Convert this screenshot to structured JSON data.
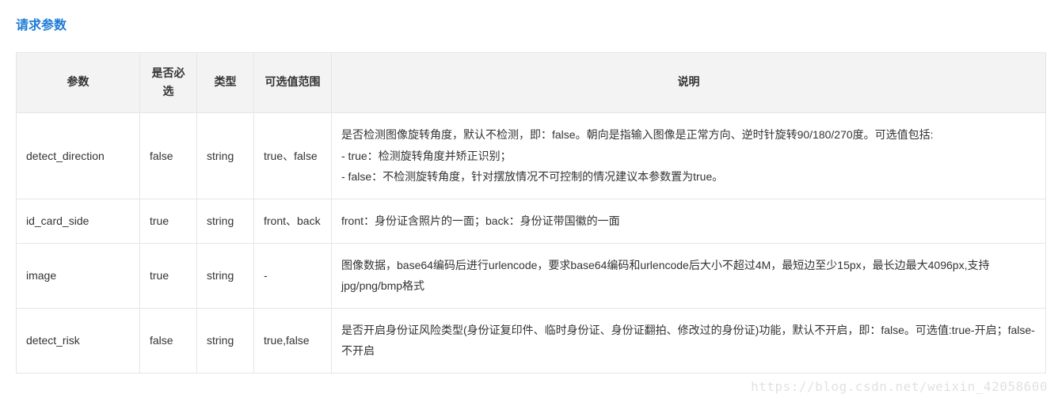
{
  "section_title": "请求参数",
  "table": {
    "headers": {
      "param": "参数",
      "required": "是否必选",
      "type": "类型",
      "range": "可选值范围",
      "desc": "说明"
    },
    "rows": [
      {
        "param": "detect_direction",
        "required": "false",
        "type": "string",
        "range": "true、false",
        "desc_lines": [
          "是否检测图像旋转角度，默认不检测，即：false。朝向是指输入图像是正常方向、逆时针旋转90/180/270度。可选值包括:",
          "- true：检测旋转角度并矫正识别；",
          "- false：不检测旋转角度，针对摆放情况不可控制的情况建议本参数置为true。"
        ]
      },
      {
        "param": "id_card_side",
        "required": "true",
        "type": "string",
        "range": "front、back",
        "desc_lines": [
          "front：身份证含照片的一面；back：身份证带国徽的一面"
        ]
      },
      {
        "param": "image",
        "required": "true",
        "type": "string",
        "range": "-",
        "desc_lines": [
          "图像数据，base64编码后进行urlencode，要求base64编码和urlencode后大小不超过4M，最短边至少15px，最长边最大4096px,支持jpg/png/bmp格式"
        ]
      },
      {
        "param": "detect_risk",
        "required": "false",
        "type": "string",
        "range": "true,false",
        "desc_lines": [
          "是否开启身份证风险类型(身份证复印件、临时身份证、身份证翻拍、修改过的身份证)功能，默认不开启，即：false。可选值:true-开启；false-不开启"
        ]
      }
    ]
  },
  "watermark": "https://blog.csdn.net/weixin_42058600"
}
